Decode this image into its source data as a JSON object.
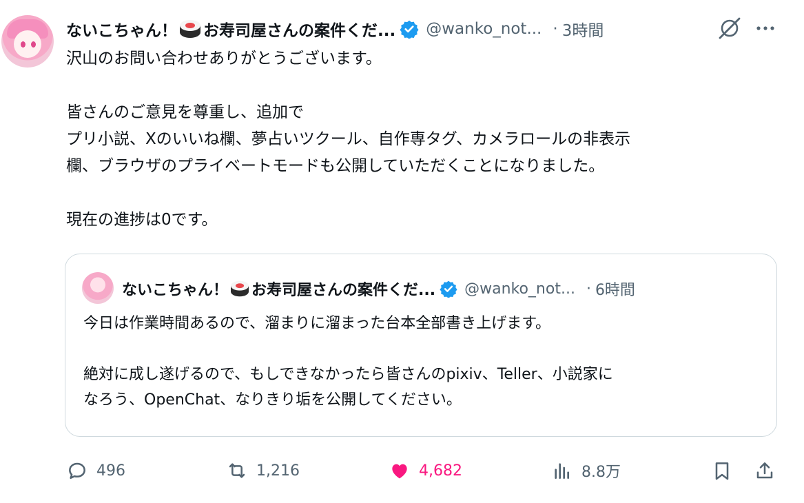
{
  "post": {
    "author_name": "ないこちゃん！",
    "author_name_rest": "お寿司屋さんの案件くだ...",
    "handle": "@wanko_not...",
    "time": "3時間",
    "body": [
      "沢山のお問い合わせありがとうございます。",
      "",
      "皆さんのご意見を尊重し、追加で",
      "プリ小説、Xのいいね欄、夢占いツクール、自作専タグ、カメラロールの非表示",
      "欄、ブラウザのプライベートモードも公開していただくことになりました。",
      "",
      "現在の進捗は0です。"
    ]
  },
  "quote": {
    "author_name": "ないこちゃん！",
    "author_name_rest": "お寿司屋さんの案件くだ...",
    "handle": "@wanko_not...",
    "time": "6時間",
    "body": [
      "今日は作業時間あるので、溜まりに溜まった台本全部書き上げます。",
      "",
      "絶対に成し遂げるので、もしできなかったら皆さんのpixiv、Teller、小説家に",
      "なろう、OpenChat、なりきり垢を公開してください。"
    ]
  },
  "actions": {
    "replies": "496",
    "reposts": "1,216",
    "likes": "4,682",
    "views": "8.8万"
  },
  "colors": {
    "like": "#f91880",
    "verified": "#1d9bf0",
    "muted": "#536471",
    "border": "#cfd9de"
  },
  "icons": [
    "verified-badge-icon",
    "grok-icon",
    "more-icon",
    "reply-icon",
    "repost-icon",
    "like-icon",
    "views-icon",
    "bookmark-icon",
    "share-icon"
  ]
}
